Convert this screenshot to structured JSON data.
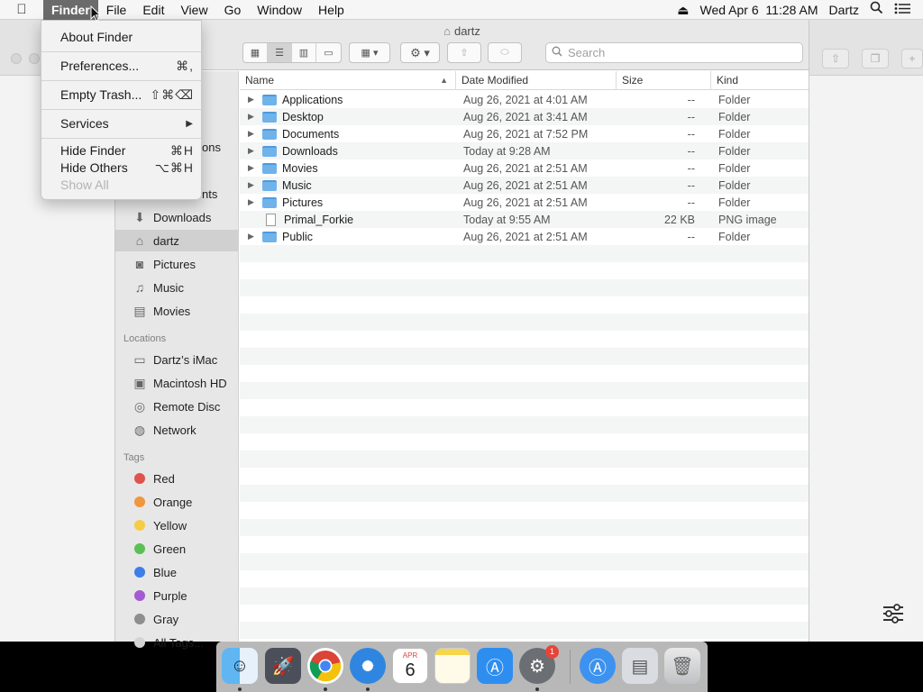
{
  "menubar": {
    "apple_icon": "apple-logo",
    "items": [
      "Finder",
      "File",
      "Edit",
      "View",
      "Go",
      "Window",
      "Help"
    ],
    "clock": "Wed Apr 6  11:28 AM",
    "user": "Dartz"
  },
  "finder_menu": {
    "about": "About Finder",
    "preferences": "Preferences...",
    "preferences_shortcut": "⌘,",
    "empty_trash": "Empty Trash...",
    "empty_trash_shortcut": "⇧⌘⌫",
    "services": "Services",
    "services_arrow": "▶",
    "hide_finder": "Hide Finder",
    "hide_finder_shortcut": "⌘H",
    "hide_others": "Hide Others",
    "hide_others_shortcut": "⌥⌘H",
    "show_all": "Show All"
  },
  "window": {
    "title": "dartz",
    "search_placeholder": "Search"
  },
  "sidebar": {
    "partial_items": [
      "ons",
      "nts"
    ],
    "favorites": [
      {
        "label": "Downloads",
        "icon": "download-icon"
      },
      {
        "label": "dartz",
        "icon": "home-icon"
      },
      {
        "label": "Pictures",
        "icon": "camera-icon"
      },
      {
        "label": "Music",
        "icon": "music-note-icon"
      },
      {
        "label": "Movies",
        "icon": "film-icon"
      }
    ],
    "locations_heading": "Locations",
    "locations": [
      {
        "label": "Dartz’s iMac",
        "icon": "computer-icon"
      },
      {
        "label": "Macintosh HD",
        "icon": "hard-drive-icon"
      },
      {
        "label": "Remote Disc",
        "icon": "disc-icon"
      },
      {
        "label": "Network",
        "icon": "globe-icon"
      }
    ],
    "tags_heading": "Tags",
    "tags": [
      {
        "label": "Red",
        "color": "#e0524c"
      },
      {
        "label": "Orange",
        "color": "#f0963c"
      },
      {
        "label": "Yellow",
        "color": "#f5cc45"
      },
      {
        "label": "Green",
        "color": "#5cbf55"
      },
      {
        "label": "Blue",
        "color": "#3d7ee8"
      },
      {
        "label": "Purple",
        "color": "#a35bcf"
      },
      {
        "label": "Gray",
        "color": "#8e8e8e"
      },
      {
        "label": "All Tags...",
        "color": "#d4d4d4"
      }
    ]
  },
  "columns": {
    "name": "Name",
    "date": "Date Modified",
    "size": "Size",
    "kind": "Kind"
  },
  "files": [
    {
      "name": "Applications",
      "date": "Aug 26, 2021 at 4:01 AM",
      "size": "--",
      "kind": "Folder",
      "type": "folder"
    },
    {
      "name": "Desktop",
      "date": "Aug 26, 2021 at 3:41 AM",
      "size": "--",
      "kind": "Folder",
      "type": "folder"
    },
    {
      "name": "Documents",
      "date": "Aug 26, 2021 at 7:52 PM",
      "size": "--",
      "kind": "Folder",
      "type": "folder"
    },
    {
      "name": "Downloads",
      "date": "Today at 9:28 AM",
      "size": "--",
      "kind": "Folder",
      "type": "folder"
    },
    {
      "name": "Movies",
      "date": "Aug 26, 2021 at 2:51 AM",
      "size": "--",
      "kind": "Folder",
      "type": "folder"
    },
    {
      "name": "Music",
      "date": "Aug 26, 2021 at 2:51 AM",
      "size": "--",
      "kind": "Folder",
      "type": "folder"
    },
    {
      "name": "Pictures",
      "date": "Aug 26, 2021 at 2:51 AM",
      "size": "--",
      "kind": "Folder",
      "type": "folder"
    },
    {
      "name": "Primal_Forkie",
      "date": "Today at 9:55 AM",
      "size": "22 KB",
      "kind": "PNG image",
      "type": "file"
    },
    {
      "name": "Public",
      "date": "Aug 26, 2021 at 2:51 AM",
      "size": "--",
      "kind": "Folder",
      "type": "folder"
    }
  ],
  "dock": {
    "calendar_month": "APR",
    "calendar_day": "6",
    "badge_count": "1",
    "apps": [
      "finder-icon",
      "launchpad-icon",
      "chrome-icon",
      "safari-icon",
      "calendar-icon",
      "notes-icon",
      "app-store-icon",
      "system-preferences-icon",
      "app-store-folder-icon",
      "preview-icon",
      "trash-icon"
    ]
  }
}
